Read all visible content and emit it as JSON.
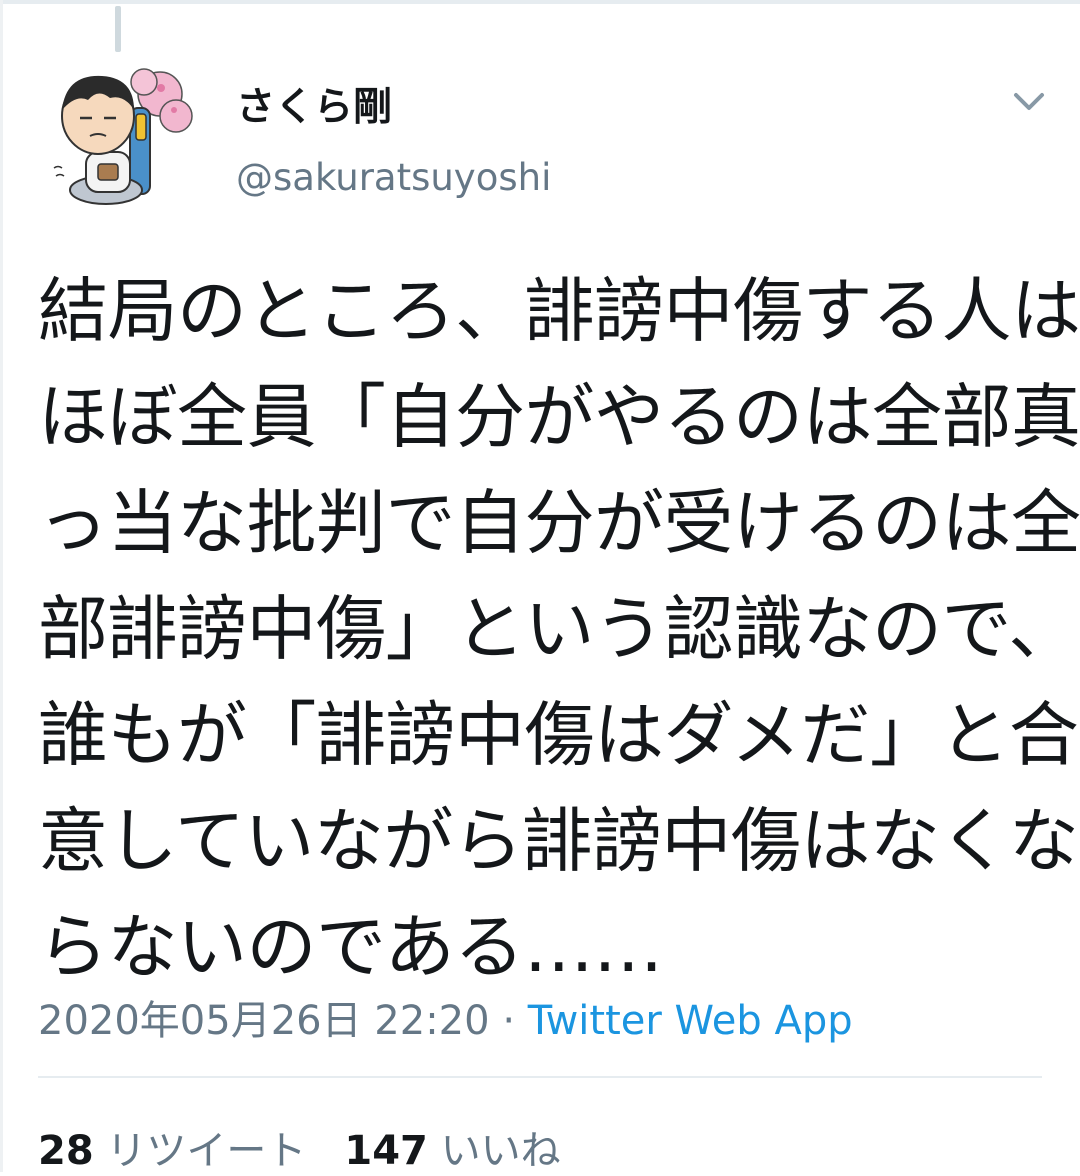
{
  "tweet": {
    "display_name": "さくら剛",
    "handle": "@sakuratsuyoshi",
    "text_lines": [
      "結局のところ、誹謗中傷する人は",
      "ほぼ全員「自分がやるのは全部真",
      "っ当な批判で自分が受けるのは全",
      "部誹謗中傷」という認識なので、",
      "誰もが「誹謗中傷はダメだ」と合",
      "意していながら誹謗中傷はなくな",
      "らないのである……"
    ],
    "timestamp": "2020年05月26日 22:20",
    "separator": "·",
    "source": "Twitter Web App"
  },
  "stats": {
    "retweets_count": "28",
    "retweets_label": "リツイート",
    "likes_count": "147",
    "likes_label": "いいね"
  },
  "colors": {
    "text": "#14171a",
    "secondary": "#657786",
    "link": "#1b95e0",
    "border": "#e6ecf0"
  },
  "icons": {
    "avatar": "cartoon-avatar",
    "caret": "chevron-down-icon"
  }
}
